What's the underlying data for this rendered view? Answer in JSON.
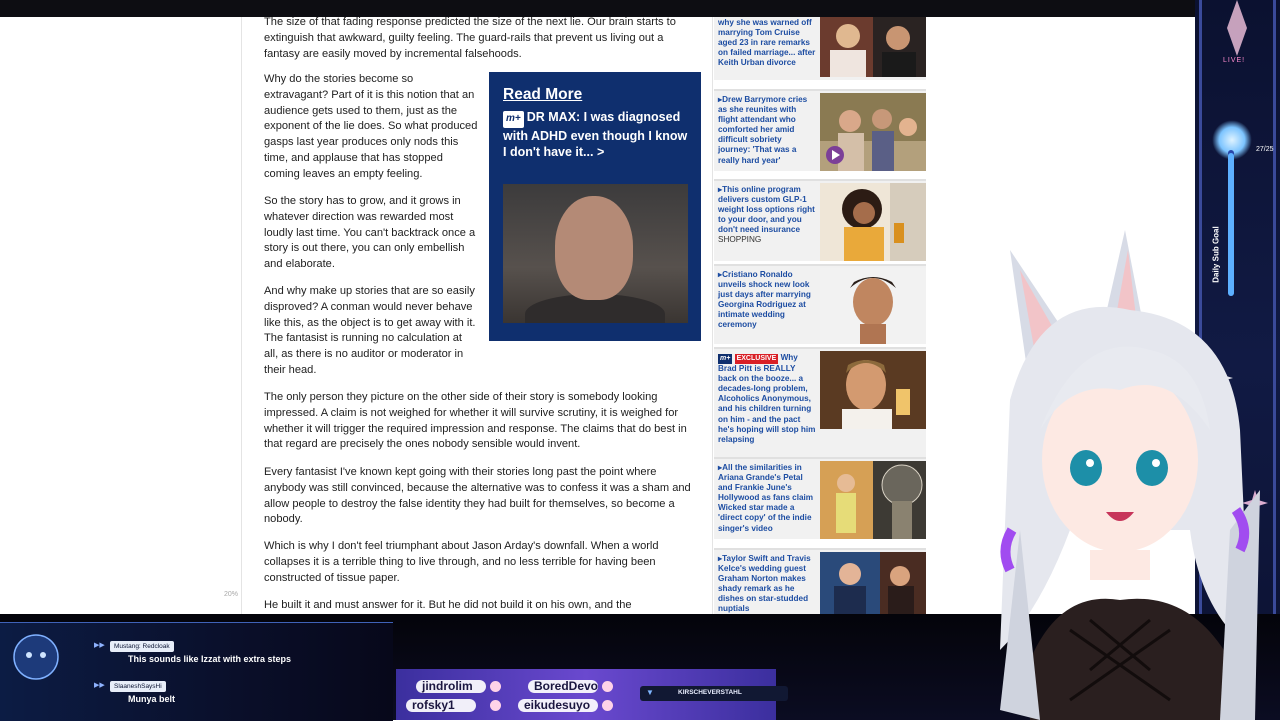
{
  "article": {
    "p1": "The size of that fading response predicted the size of the next lie. Our brain starts to extinguish that awkward, guilty feeling. The guard-rails that prevent us living out a fantasy are easily moved by incremental falsehoods.",
    "p2": "Why do the stories become so extravagant? Part of it is this notion that an audience gets used to them, just as the exponent of the lie does. So what produced gasps last year produces only nods this time, and applause that has stopped coming leaves an empty feeling.",
    "p3": "So the story has to grow, and it grows in whatever direction was rewarded most loudly last time. You can't backtrack once a story is out there, you can only embellish and elaborate.",
    "p4": "And why make up stories that are so easily disproved? A conman would never behave like this, as the object is to get away with it. The fantasist is running no calculation at all, as there is no auditor or moderator in their head.",
    "p5": "The only person they picture on the other side of their story is somebody looking impressed. A claim is not weighed for whether it will survive scrutiny, it is weighed for whether it will trigger the required impression and response. The claims that do best in that regard are precisely the ones nobody sensible would invent.",
    "p6": "Every fantasist I've known kept going with their stories long past the point where anybody was still convinced, because the alternative was to confess it was a sham and allow people to destroy the false identity they had built for themselves, so become a nobody.",
    "p7": "Which is why I don't feel triumphant about Jason Arday's downfall. When a world collapses it is a terrible thing to live through, and no less terrible for having been constructed of tissue paper.",
    "p8": "He built it and must answer for it. But he did not build it on his own, and the",
    "zoom": "20%"
  },
  "read_more": {
    "title": "Read More",
    "badge": "m+",
    "headline": "DR MAX: I was diagnosed with ADHD even though I know I don't have it...",
    "arrow": ">"
  },
  "sidebar": {
    "items": [
      {
        "headline": "why she was warned off marrying Tom Cruise aged 23 in rare remarks on failed marriage... after Keith Urban divorce"
      },
      {
        "headline": "Drew Barrymore cries as she reunites with flight attendant who comforted her amid difficult sobriety journey: 'That was a really hard year'"
      },
      {
        "headline": "This online program delivers custom GLP-1 weight loss options right to your door, and you don't need insurance",
        "label": "SHOPPING"
      },
      {
        "headline": "Cristiano Ronaldo unveils shock new look just days after marrying Georgina Rodriguez at intimate wedding ceremony"
      },
      {
        "badge1": "m+",
        "badge2": "EXCLUSIVE",
        "headline": "Why Brad Pitt is REALLY back on the booze... a decades-long problem, Alcoholics Anonymous, and his children turning on him - and the pact he's hoping will stop him relapsing"
      },
      {
        "headline": "All the similarities in Ariana Grande's Petal and Frankie June's Hollywood as fans claim Wicked star made a 'direct copy' of the indie singer's video"
      },
      {
        "headline": "Taylor Swift and Travis Kelce's wedding guest Graham Norton makes shady remark as he dishes on star-studded nuptials"
      }
    ]
  },
  "stream": {
    "live_label": "LIVE!",
    "goal_label": "Daily Sub Goal",
    "goal_count": "27/25",
    "goal_fraction": 0.98,
    "chat": [
      {
        "user": "Mustang: Redcloak",
        "message": "This sounds like Izzat with extra steps"
      },
      {
        "user": "SlaaneshSaysHi",
        "message": "Munya belt"
      }
    ],
    "ticker": [
      "jindrolim",
      "BoredDevo",
      "rofsky1",
      "eikudesuyo"
    ],
    "social_handle": "KIRSCHEVERSTAHL"
  },
  "colors": {
    "link_blue": "#1d4da2",
    "read_more_bg": "#0f2f6e",
    "exclusive_red": "#d91f26",
    "chat_bg": "#0c1c44",
    "ticker_purple": "#6a49cf"
  }
}
